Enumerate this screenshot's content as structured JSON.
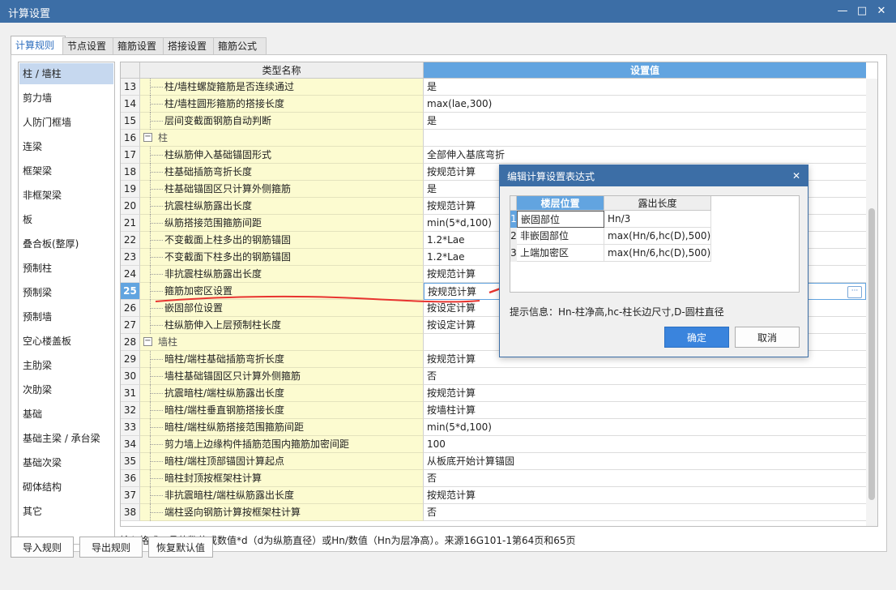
{
  "window": {
    "title": "计算设置"
  },
  "tabs": [
    "计算规则",
    "节点设置",
    "箍筋设置",
    "搭接设置",
    "箍筋公式"
  ],
  "sidebar": {
    "items": [
      "柱 / 墙柱",
      "剪力墙",
      "人防门框墙",
      "连梁",
      "框架梁",
      "非框架梁",
      "板",
      "叠合板(整厚)",
      "预制柱",
      "预制梁",
      "预制墙",
      "空心楼盖板",
      "主肋梁",
      "次肋梁",
      "基础",
      "基础主梁 / 承台梁",
      "基础次梁",
      "砌体结构",
      "其它"
    ]
  },
  "grid": {
    "col_name": "类型名称",
    "col_value": "设置值",
    "rows": [
      {
        "num": "13",
        "name": "柱/墙柱螺旋箍筋是否连续通过",
        "value": "是"
      },
      {
        "num": "14",
        "name": "柱/墙柱圆形箍筋的搭接长度",
        "value": "max(lae,300)"
      },
      {
        "num": "15",
        "name": "层间变截面钢筋自动判断",
        "value": "是"
      },
      {
        "num": "16",
        "name": "柱",
        "value": "",
        "group": true
      },
      {
        "num": "17",
        "name": "柱纵筋伸入基础锚固形式",
        "value": "全部伸入基底弯折"
      },
      {
        "num": "18",
        "name": "柱基础插筋弯折长度",
        "value": "按规范计算"
      },
      {
        "num": "19",
        "name": "柱基础锚固区只计算外侧箍筋",
        "value": "是"
      },
      {
        "num": "20",
        "name": "抗震柱纵筋露出长度",
        "value": "按规范计算"
      },
      {
        "num": "21",
        "name": "纵筋搭接范围箍筋间距",
        "value": "min(5*d,100)"
      },
      {
        "num": "22",
        "name": "不变截面上柱多出的钢筋锚固",
        "value": "1.2*Lae"
      },
      {
        "num": "23",
        "name": "不变截面下柱多出的钢筋锚固",
        "value": "1.2*Lae"
      },
      {
        "num": "24",
        "name": "非抗震柱纵筋露出长度",
        "value": "按规范计算"
      },
      {
        "num": "25",
        "name": "箍筋加密区设置",
        "value": "按规范计算",
        "editing": true
      },
      {
        "num": "26",
        "name": "嵌固部位设置",
        "value": "按设定计算"
      },
      {
        "num": "27",
        "name": "柱纵筋伸入上层预制柱长度",
        "value": "按设定计算"
      },
      {
        "num": "28",
        "name": "墙柱",
        "value": "",
        "group": true
      },
      {
        "num": "29",
        "name": "暗柱/端柱基础插筋弯折长度",
        "value": "按规范计算"
      },
      {
        "num": "30",
        "name": "墙柱基础锚固区只计算外侧箍筋",
        "value": "否"
      },
      {
        "num": "31",
        "name": "抗震暗柱/端柱纵筋露出长度",
        "value": "按规范计算"
      },
      {
        "num": "32",
        "name": "暗柱/端柱垂直钢筋搭接长度",
        "value": "按墙柱计算"
      },
      {
        "num": "33",
        "name": "暗柱/端柱纵筋搭接范围箍筋间距",
        "value": "min(5*d,100)"
      },
      {
        "num": "34",
        "name": "剪力墙上边缘构件插筋范围内箍筋加密间距",
        "value": "100"
      },
      {
        "num": "35",
        "name": "暗柱/端柱顶部锚固计算起点",
        "value": "从板底开始计算锚固"
      },
      {
        "num": "36",
        "name": "暗柱封顶按框架柱计算",
        "value": "否"
      },
      {
        "num": "37",
        "name": "非抗震暗柱/端柱纵筋露出长度",
        "value": "按规范计算"
      },
      {
        "num": "38",
        "name": "端柱竖向钢筋计算按框架柱计算",
        "value": "否"
      }
    ]
  },
  "hint": "输入格式：具体数值或数值*d（d为纵筋直径）或Hn/数值（Hn为层净高）。来源16G101-1第64页和65页",
  "buttons": {
    "import": "导入规则",
    "export": "导出规则",
    "restore": "恢复默认值"
  },
  "dialog": {
    "title": "编辑计算设置表达式",
    "col1": "楼层位置",
    "col2": "露出长度",
    "rows": [
      {
        "num": "1",
        "pos": "嵌固部位",
        "len": "Hn/3"
      },
      {
        "num": "2",
        "pos": "非嵌固部位",
        "len": "max(Hn/6,hc(D),500)"
      },
      {
        "num": "3",
        "pos": "上端加密区",
        "len": "max(Hn/6,hc(D),500)"
      }
    ],
    "hint": "提示信息：Hn-柱净高,hc-柱长边尺寸,D-圆柱直径",
    "ok": "确定",
    "cancel": "取消"
  },
  "colors": {
    "accent": "#3c6ea6",
    "header_blue": "#62a4e0",
    "name_bg": "#fcfbd0",
    "annotation_red": "#e8342f"
  }
}
